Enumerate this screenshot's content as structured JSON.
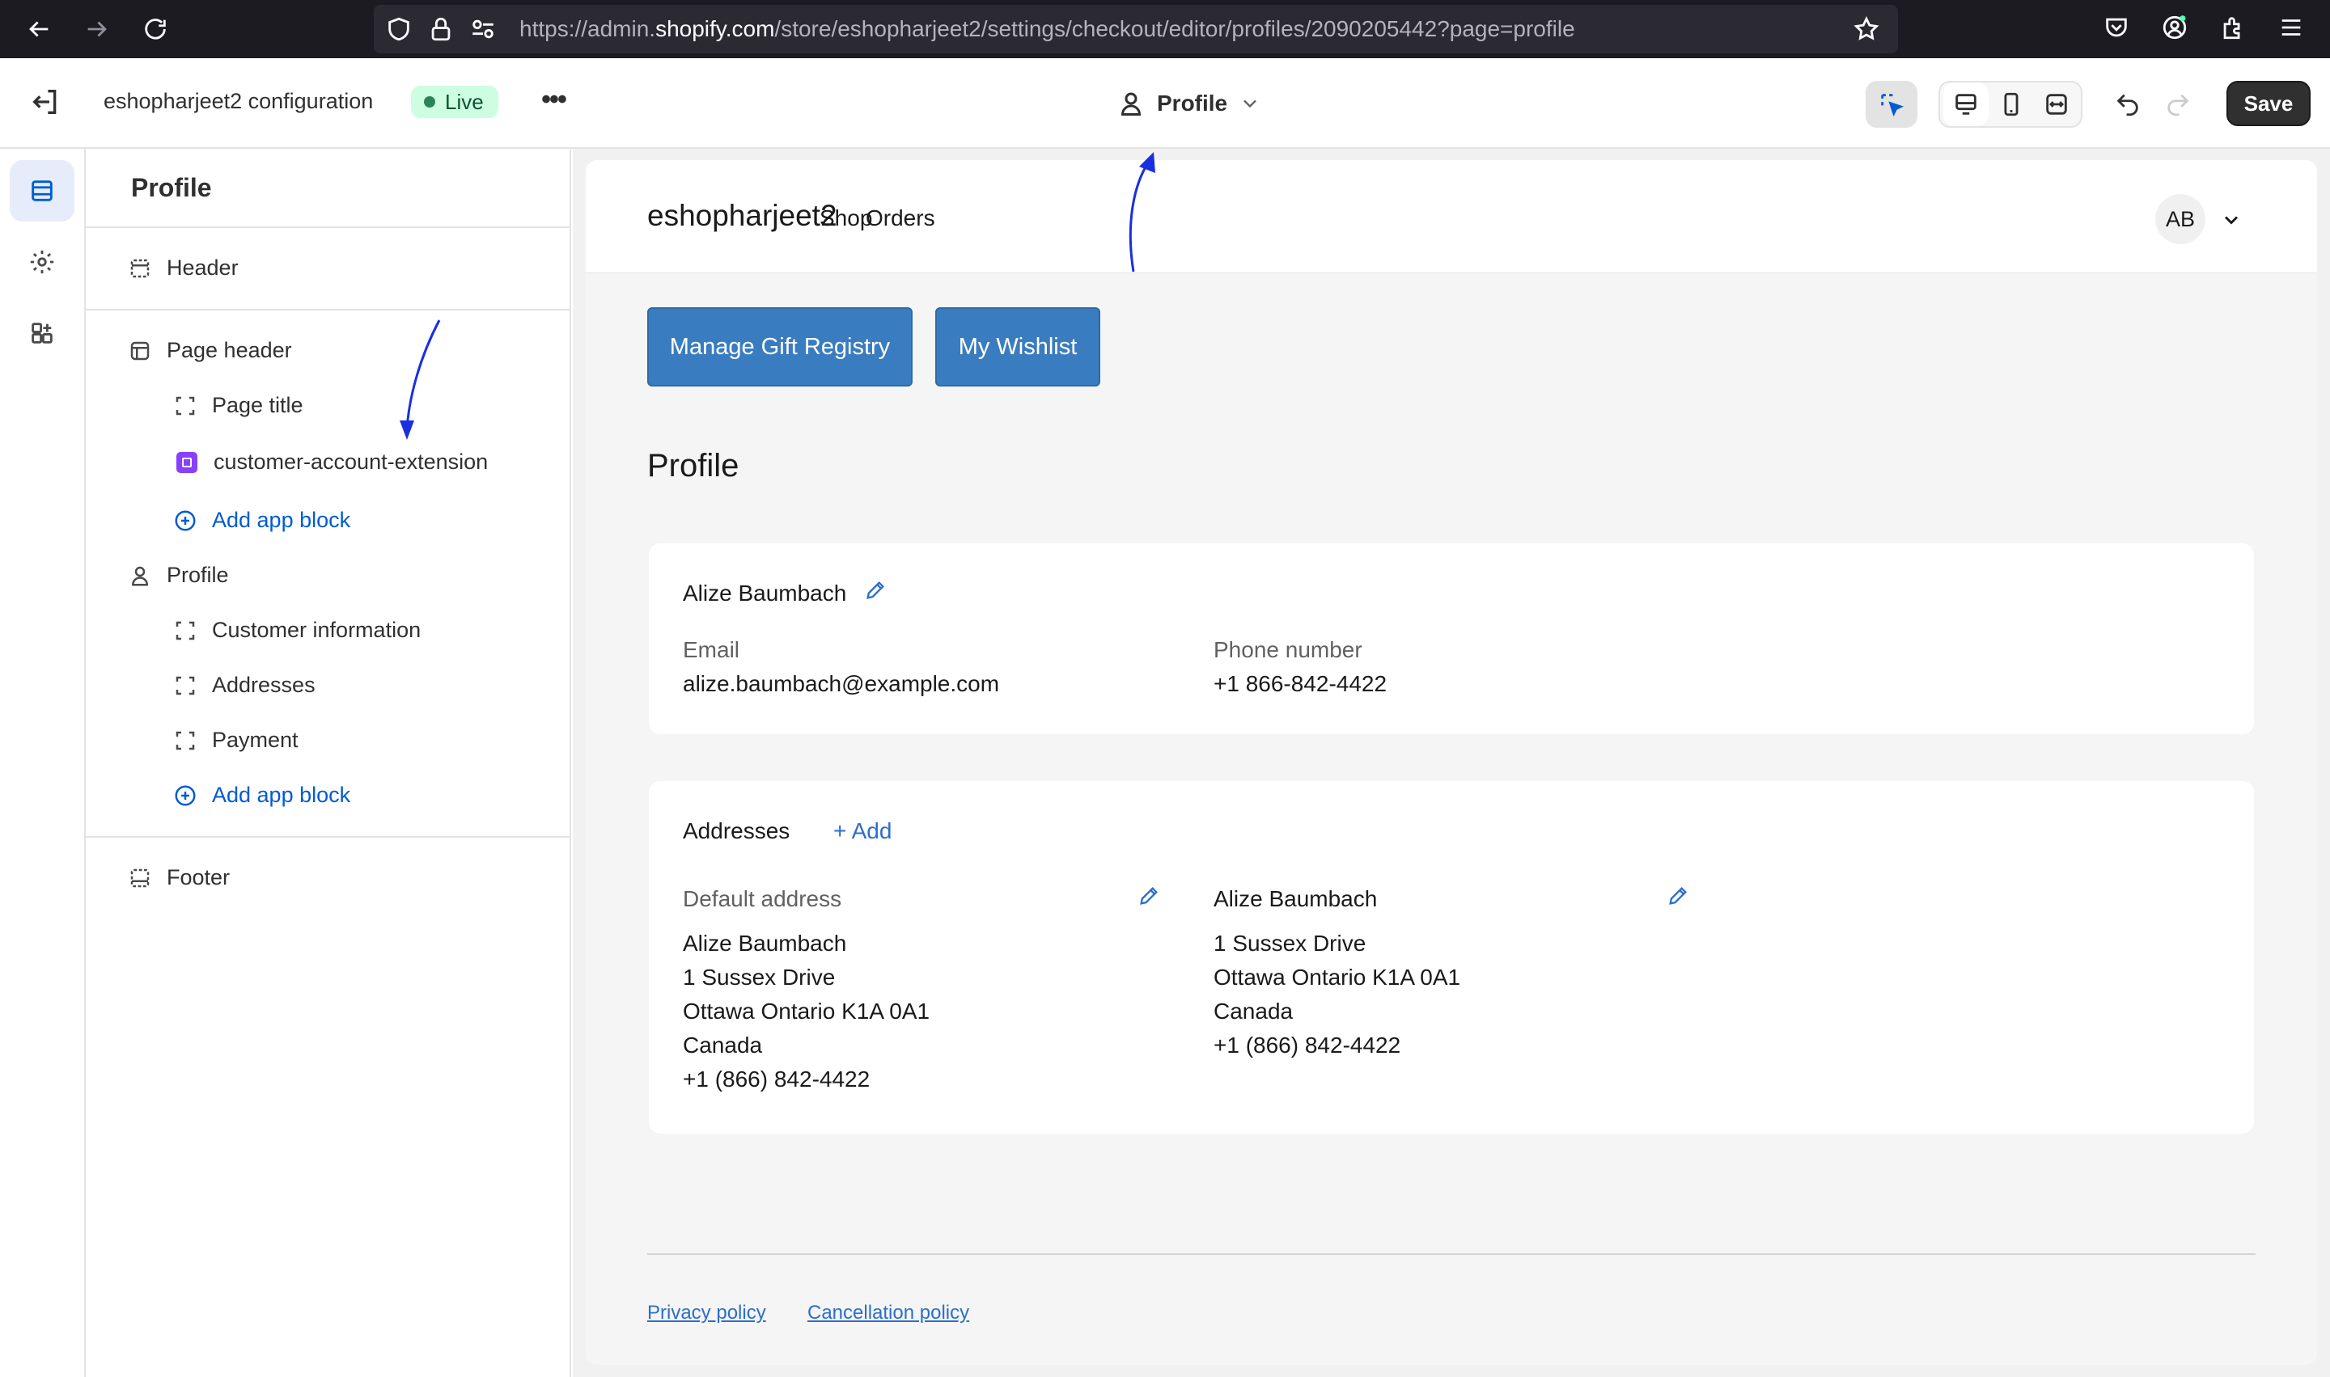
{
  "browser": {
    "url_prefix": "https://admin.",
    "url_domain": "shopify.com",
    "url_path": "/store/eshopharjeet2/settings/checkout/editor/profiles/2090205442?page=profile"
  },
  "editor": {
    "config_title": "eshopharjeet2 configuration",
    "live_badge": "Live",
    "page_selector": "Profile",
    "save_label": "Save"
  },
  "sidebar": {
    "title": "Profile",
    "items": [
      {
        "label": "Header"
      },
      {
        "label": "Page header"
      },
      {
        "label": "Page title"
      },
      {
        "label": "customer-account-extension"
      },
      {
        "label": "Add app block"
      },
      {
        "label": "Profile"
      },
      {
        "label": "Customer information"
      },
      {
        "label": "Addresses"
      },
      {
        "label": "Payment"
      },
      {
        "label": "Add app block"
      },
      {
        "label": "Footer"
      }
    ]
  },
  "store": {
    "name": "eshopharjeet2",
    "nav": [
      "Shop",
      "Orders"
    ],
    "avatar_initials": "AB",
    "buttons": [
      "Manage Gift Registry",
      "My Wishlist"
    ],
    "heading": "Profile",
    "customer": {
      "name": "Alize Baumbach",
      "email_label": "Email",
      "email": "alize.baumbach@example.com",
      "phone_label": "Phone number",
      "phone": "+1 866-842-4422"
    },
    "addresses": {
      "title": "Addresses",
      "add_label": "+ Add",
      "default_label": "Default address",
      "default_lines": [
        "Alize Baumbach",
        "1 Sussex Drive",
        "Ottawa Ontario K1A 0A1",
        "Canada",
        "+1 (866) 842-4422"
      ],
      "second_name": "Alize Baumbach",
      "second_lines": [
        "1 Sussex Drive",
        "Ottawa Ontario K1A 0A1",
        "Canada",
        "+1 (866) 842-4422"
      ]
    },
    "footer_links": [
      "Privacy policy",
      "Cancellation policy"
    ]
  },
  "colors": {
    "accent": "#005bd3",
    "link": "#2c6ecb",
    "cta": "#3a7cc0",
    "live_bg": "#cdfee1",
    "annotation": "#1a2fe0"
  }
}
